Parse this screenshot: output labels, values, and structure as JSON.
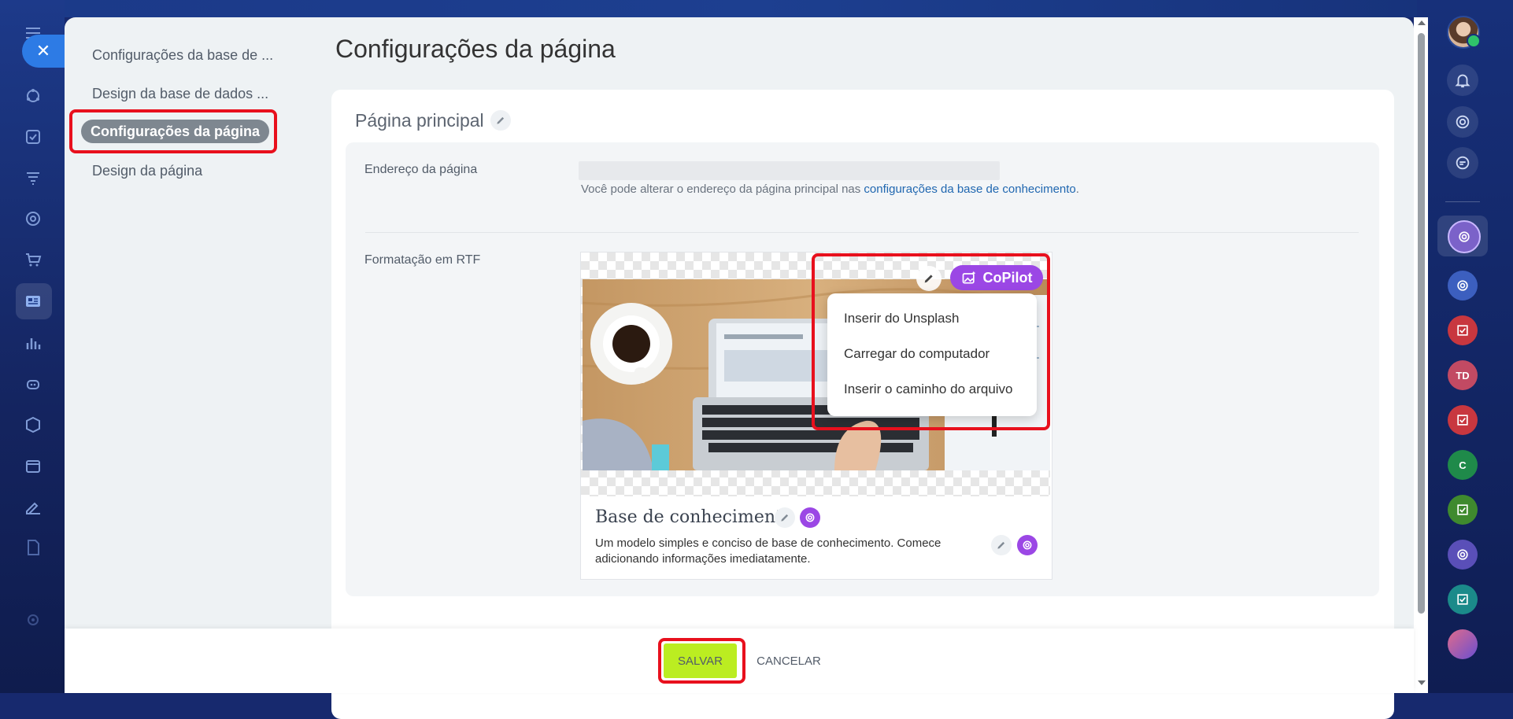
{
  "sidebar": {
    "items": [
      {
        "label": "Configurações da base de ..."
      },
      {
        "label": "Design da base de dados ..."
      },
      {
        "label": "Configurações da página"
      },
      {
        "label": "Design da página"
      }
    ]
  },
  "page": {
    "title": "Configurações da página"
  },
  "section": {
    "title": "Página principal"
  },
  "address": {
    "label": "Endereço da página",
    "hint_prefix": "Você pode alterar o endereço da página principal nas ",
    "hint_link": "configurações da base de conhecimento",
    "hint_suffix": "."
  },
  "rtf": {
    "label": "Formatação em RTF",
    "copilot_label": "CoPilot",
    "menu": [
      {
        "label": "Inserir do Unsplash"
      },
      {
        "label": "Carregar do computador"
      },
      {
        "label": "Inserir o caminho do arquivo"
      }
    ],
    "card_title": "Base de conhecimento",
    "card_desc": "Um modelo simples e conciso de base de conhecimento. Comece adicionando informações imediatamente."
  },
  "footer": {
    "save_label": "SALVAR",
    "cancel_label": "CANCELAR"
  },
  "right_rail": {
    "chat_initials_1": "TD",
    "chat_initials_2": "C"
  },
  "colors": {
    "accent": "#9b47e5",
    "save": "#bbed21",
    "highlight": "#e8101d",
    "link": "#2067b0"
  }
}
